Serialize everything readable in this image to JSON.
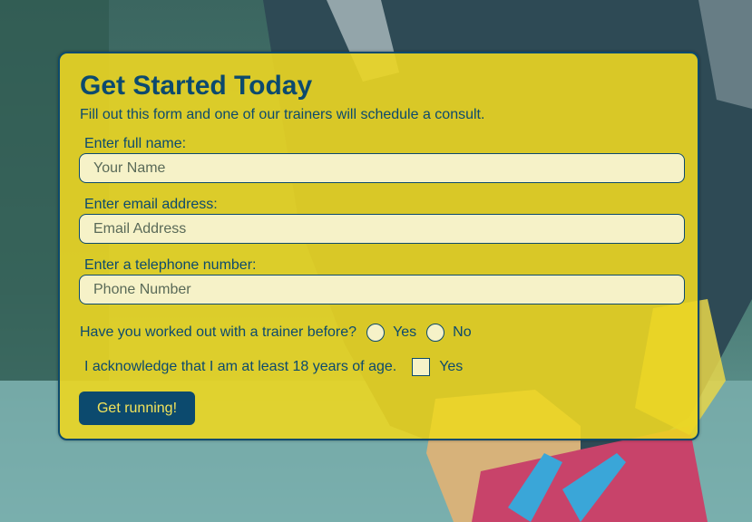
{
  "form": {
    "title": "Get Started Today",
    "subtitle": "Fill out this form and one of our trainers will schedule a consult.",
    "name_label": "Enter full name:",
    "name_placeholder": "Your Name",
    "name_value": "",
    "email_label": "Enter email address:",
    "email_placeholder": "Email Address",
    "email_value": "",
    "phone_label": "Enter a telephone number:",
    "phone_placeholder": "Phone Number",
    "phone_value": "",
    "trainer_question": "Have you worked out with a trainer before?",
    "trainer_options": [
      "Yes",
      "No"
    ],
    "trainer_selected": null,
    "age_ack_text": "I acknowledge that I am at least 18 years of age.",
    "age_ack_option": "Yes",
    "age_ack_checked": false,
    "submit_label": "Get running!"
  },
  "colors": {
    "primary": "#0c4a6e",
    "card_background": "#ecd622",
    "input_background": "#f6f2c8",
    "button_text": "#f3e35a"
  },
  "background": {
    "icon": "runner-tying-shoelaces-photo"
  }
}
